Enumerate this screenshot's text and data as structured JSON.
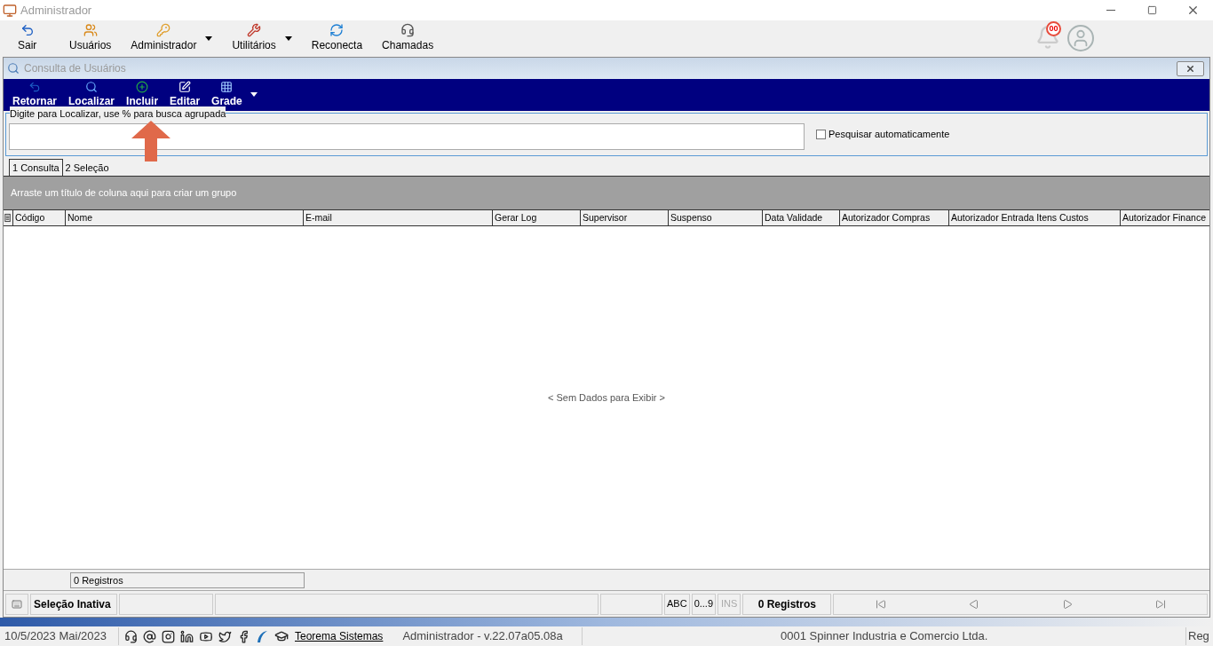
{
  "window": {
    "title": "Administrador"
  },
  "toolbar": [
    {
      "label": "Sair",
      "dropdown": false
    },
    {
      "label": "Usuários",
      "dropdown": false
    },
    {
      "label": "Administrador",
      "dropdown": true
    },
    {
      "label": "Utilitários",
      "dropdown": true
    },
    {
      "label": "Reconecta",
      "dropdown": false
    },
    {
      "label": "Chamadas",
      "dropdown": false
    }
  ],
  "notifications": {
    "count": "00"
  },
  "child_window": {
    "title": "Consulta de Usuários",
    "toolbar": [
      {
        "label": "Retornar"
      },
      {
        "label": "Localizar"
      },
      {
        "label": "Incluir"
      },
      {
        "label": "Editar"
      },
      {
        "label": "Grade"
      }
    ],
    "search": {
      "label": "Digite para Localizar, use % para busca agrupada"
    },
    "auto_search": {
      "label": "Pesquisar automaticamente",
      "checked": false
    },
    "tabs": [
      {
        "label": "1 Consulta",
        "selected": true
      },
      {
        "label": "2 Seleção",
        "selected": false
      }
    ],
    "group_panel": "Arraste um título de coluna aqui para criar um grupo",
    "columns": [
      "Código",
      "Nome",
      "E-mail",
      "Gerar Log",
      "Supervisor",
      "Suspenso",
      "Data Validade",
      "Autorizador Compras",
      "Autorizador Entrada Itens Custos",
      "Autorizador Finance"
    ],
    "empty_text": "< Sem Dados para Exibir >",
    "footer_count": "0 Registros",
    "status": {
      "selection": "Seleção Inativa",
      "abc": "ABC",
      "digits": "0...9",
      "ins": "INS",
      "ins_disabled": true,
      "records": "0 Registros"
    }
  },
  "bottom_bar": {
    "date": "10/5/2023 Mai/2023",
    "link": "Teorema Sistemas",
    "user": "Administrador - v.22.07a05.08a",
    "company": "0001 Spinner Industria e Comercio Ltda.",
    "right": "Reg"
  }
}
